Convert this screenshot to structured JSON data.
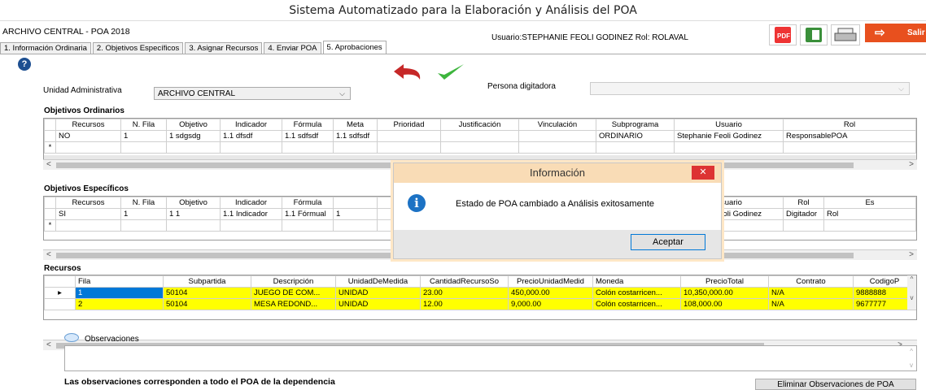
{
  "window": {
    "title": "Sistema Automatizado para la Elaboración y Análisis del POA"
  },
  "header": {
    "context": "ARCHIVO CENTRAL - POA 2018",
    "user_text": "Usuario:STEPHANIE FEOLI GODINEZ  Rol: ROLAVAL",
    "exit_label": "Salir"
  },
  "tabs": [
    {
      "label": "1. Información Ordinaria"
    },
    {
      "label": "2. Objetivos Específicos"
    },
    {
      "label": "3. Asignar Recursos"
    },
    {
      "label": "4. Enviar POA"
    },
    {
      "label": "5. Aprobaciones"
    }
  ],
  "form": {
    "unidad_label": "Unidad Administrativa",
    "unidad_value": "ARCHIVO CENTRAL",
    "persona_label": "Persona digitadora",
    "persona_value": ""
  },
  "ordinarios": {
    "title": "Objetivos Ordinarios",
    "columns": [
      "Recursos",
      "N. Fila",
      "Objetivo",
      "Indicador",
      "Fórmula",
      "Meta",
      "Prioridad",
      "Justificación",
      "Vinculación",
      "Subprograma",
      "Usuario",
      "Rol"
    ],
    "rows": [
      [
        "NO",
        "1",
        "1 sdgsdg",
        "1.1 dfsdf",
        "1.1 sdfsdf",
        "1.1 sdfsdf",
        "",
        "",
        "",
        "ORDINARIO",
        "Stephanie Feoli Godinez",
        "ResponsablePOA"
      ]
    ]
  },
  "especificos": {
    "title": "Objetivos Específicos",
    "columns": [
      "Recursos",
      "N. Fila",
      "Objetivo",
      "Indicador",
      "Fórmula",
      "",
      "",
      "",
      "",
      "a",
      "Usuario",
      "Rol",
      "Es"
    ],
    "rows": [
      [
        "SI",
        "1",
        "1 1",
        "1.1 Indicador",
        "1.1 Fórmual",
        "1",
        "",
        "",
        "",
        "",
        "Stephanie Feoli Godinez",
        "Digitador",
        "Rol"
      ]
    ]
  },
  "recursos": {
    "title": "Recursos",
    "columns": [
      "Fila",
      "Subpartida",
      "Descripción",
      "UnidadDeMedida",
      "CantidadRecursoSo",
      "PrecioUnidadMedid",
      "Moneda",
      "PrecioTotal",
      "Contrato",
      "CodigoP"
    ],
    "rows": [
      [
        "1",
        "50104",
        "JUEGO DE COM...",
        "UNIDAD",
        "23.00",
        "450,000.00",
        "Colón costarricen...",
        "10,350,000.00",
        "N/A",
        "9888888"
      ],
      [
        "2",
        "50104",
        "MESA REDOND...",
        "UNIDAD",
        "12.00",
        "9,000.00",
        "Colón costarricen...",
        "108,000.00",
        "N/A",
        "9677777"
      ]
    ]
  },
  "observaciones": {
    "label": "Observaciones",
    "value": "",
    "note": "Las observaciones corresponden a todo el POA de la dependencia",
    "delete_label": "Eliminar Observaciones de POA"
  },
  "dialog": {
    "title": "Información",
    "message": "Estado de POA cambiado a Análisis exitosamente",
    "ok_label": "Aceptar"
  },
  "colors": {
    "accent": "#0078d7",
    "highlight": "#ffff00",
    "exit": "#e8501e"
  }
}
